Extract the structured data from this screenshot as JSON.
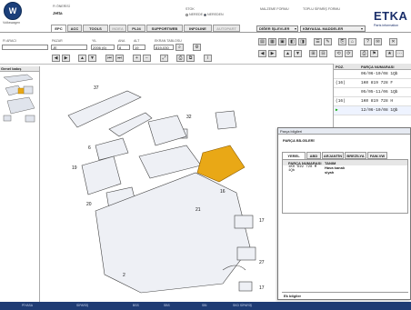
{
  "header": {
    "brand": "Volkswagen",
    "fi_label": "Fi ÖNERİSİ",
    "model": "Jetta",
    "stok_label": "STOK",
    "stok_nerede": "NEREDE",
    "stok_nereden": "NEREDEN",
    "malzeme_label": "MALZEME FORMU",
    "toplu_label": "TOPLU SİPARİŞ FORMU",
    "app_name": "ETKA",
    "app_sub": "Parts information"
  },
  "tabs": [
    {
      "label": "EPC",
      "state": "active"
    },
    {
      "label": "ACC",
      "state": "normal"
    },
    {
      "label": "TOOLS",
      "state": "normal"
    },
    {
      "label": "INDEA",
      "state": "disabled"
    },
    {
      "label": "PL24",
      "state": "normal"
    },
    {
      "label": "SUPPORTWEB",
      "state": "normal"
    },
    {
      "label": "INFOLINE",
      "state": "normal"
    },
    {
      "label": "AUTOPART",
      "state": "disabled"
    }
  ],
  "dropdowns": {
    "diger": "DİĞER İŞLEVLER",
    "kimyasal": "KİMYASAL MADDELER"
  },
  "selectors": {
    "label_marka": "FI ARACI",
    "label_pazar": "PAZAR",
    "label_yil": "YIL",
    "label_ana": "ANA",
    "label_alt": "ALT",
    "label_ekran": "EKRAN TABLOSU",
    "pazar": "JE",
    "yil": "2006 (6)",
    "ana": "8",
    "alt": "19",
    "ekran": "819-030"
  },
  "left_panel": {
    "title": "Genel bakış"
  },
  "right_list": {
    "col_poz": "POZ.",
    "col_parca": "PARÇA NUMARASI",
    "rows": [
      {
        "poz": "",
        "text": "06/06-10/08 1Qb"
      },
      {
        "poz": "(16)",
        "text": "1K0 819 728 F"
      },
      {
        "poz": "",
        "text": "05/05-11/06 1Qb"
      },
      {
        "poz": "(16)",
        "text": "1K0 819 728 H"
      },
      {
        "poz": "",
        "text": "12/06-10/08 1Qb"
      }
    ]
  },
  "dialog": {
    "title": "Parça bilgileri",
    "section": "PARÇA BİLGİLERİ",
    "tabs": [
      "YEREL PAZAR",
      "ABD",
      "ARJANTİN",
      "BREZİLYA",
      "FAW-VW"
    ],
    "table_headers": {
      "parca": "PARÇA NUMARASI",
      "tanim": "TANIM"
    },
    "row": {
      "parca": "1K0 819 728 M 1Qb",
      "tanim1": "Hava kanalı",
      "tanim2": "siyah"
    },
    "ek_bilgiler": "Ek bilgiler"
  },
  "diagram": {
    "labels": [
      "37",
      "32",
      "16",
      "6",
      "19",
      "20",
      "21",
      "2",
      "17",
      "27",
      "17"
    ]
  },
  "footer": {
    "items": [
      "PİYASA",
      "SİPARİŞ",
      "BSS",
      "SBS",
      "SBI",
      "SKD SİPARİŞ"
    ]
  },
  "colors": {
    "brand": "#1b2f6a",
    "footer": "#1f3c74",
    "highlight_part": "#e9a816"
  }
}
